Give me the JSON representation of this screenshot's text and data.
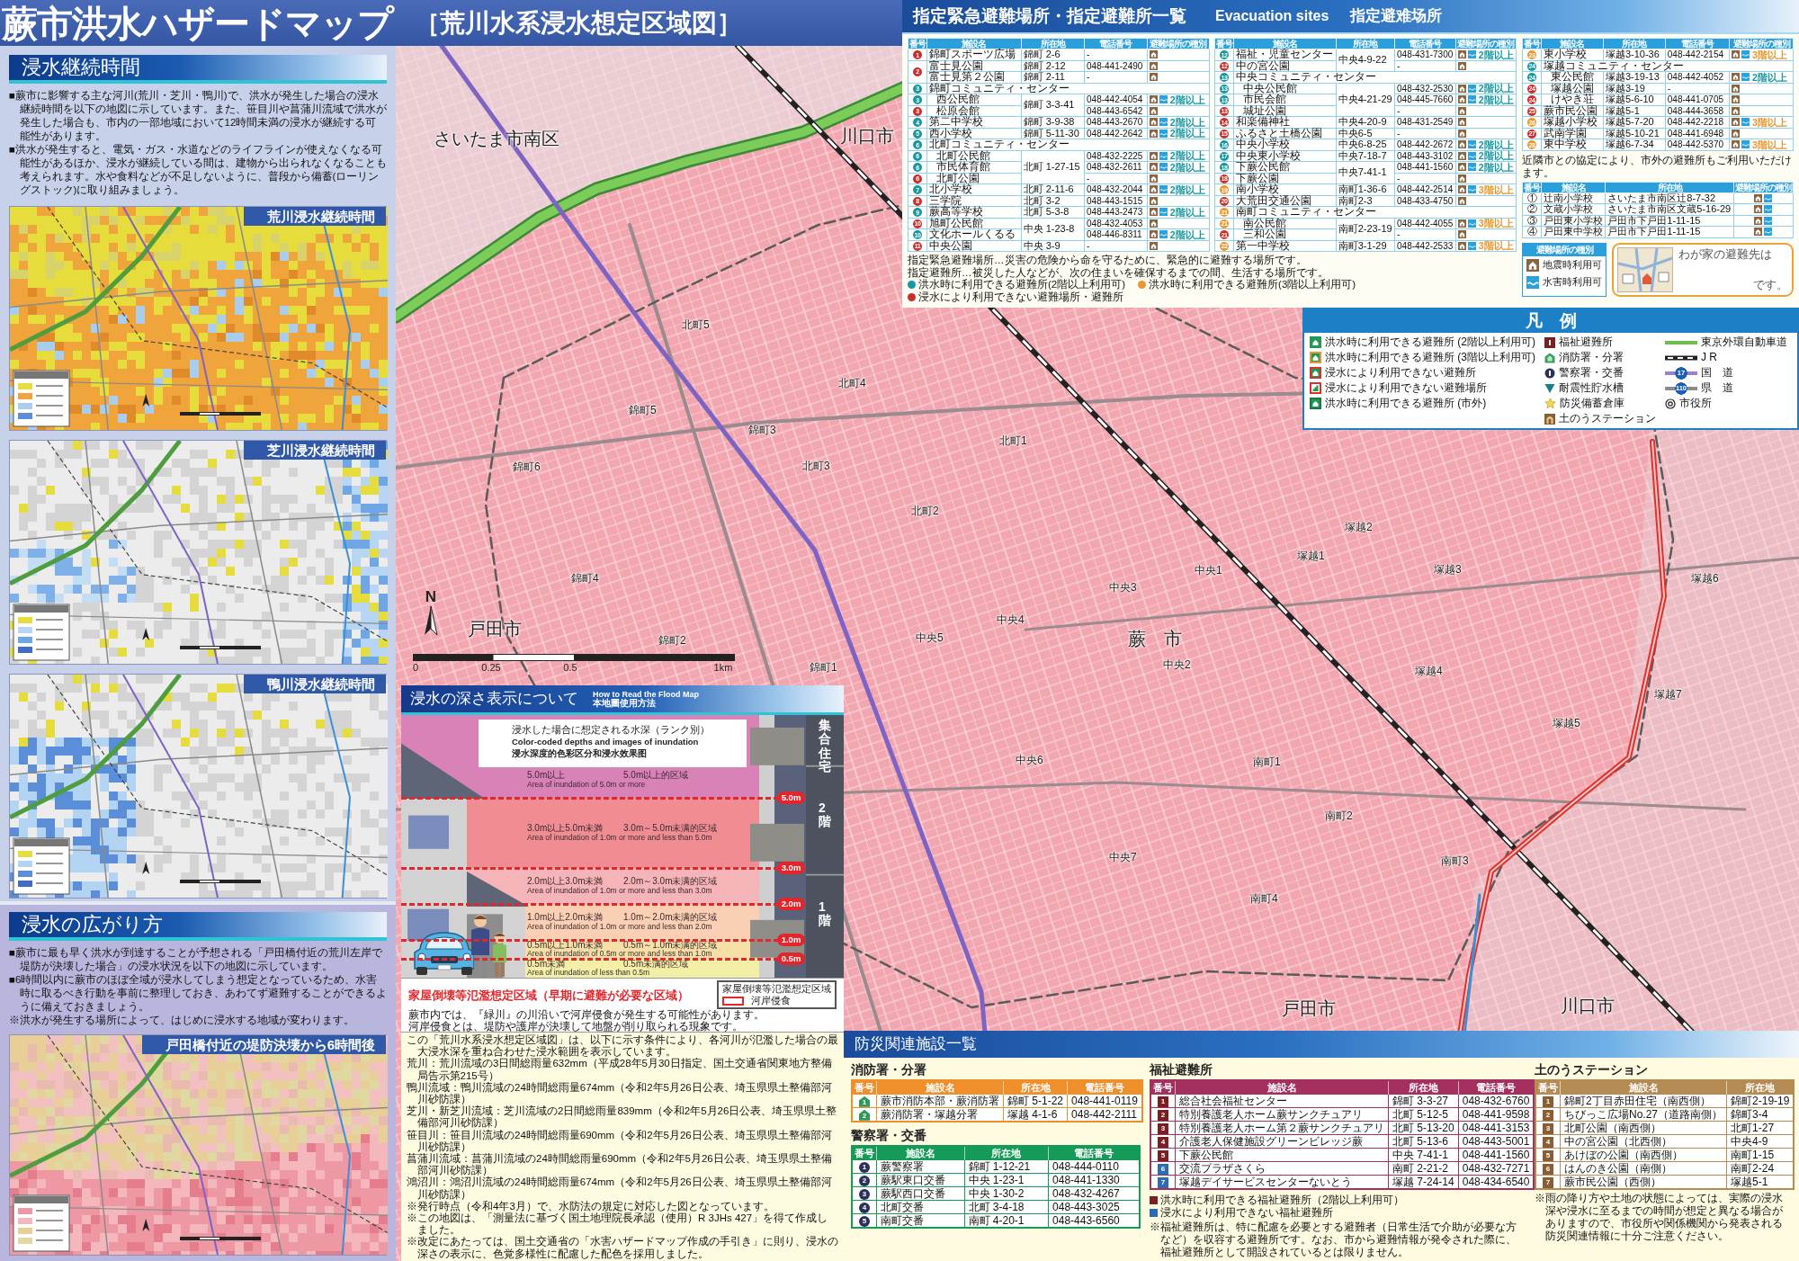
{
  "header": {
    "title": "蕨市洪水ハザードマップ",
    "subtitle": "［荒川水系浸水想定区域図］"
  },
  "duration": {
    "heading": "浸水継続時間",
    "paragraphs": [
      "■蕨市に影響する主な河川(荒川・芝川・鴨川)で、洪水が発生した場合の浸水継続時間を以下の地図に示しています。また、笹目川や菖蒲川流域で洪水が発生した場合も、市内の一部地域において12時間未満の浸水が継続する可能性があります。",
      "■洪水が発生すると、電気・ガス・水道などのライフラインが使えなくなる可能性があるほか、浸水が継続している間は、建物から出られなくなることも考えられます。水や食料などが不足しないように、普段から備蓄(ローリングストック)に取り組みましょう。"
    ],
    "maps": [
      {
        "title": "荒川浸水継続時間",
        "kind": "wide"
      },
      {
        "title": "芝川浸水継続時間",
        "kind": "east"
      },
      {
        "title": "鴨川浸水継続時間",
        "kind": "west"
      }
    ]
  },
  "spread": {
    "heading": "浸水の広がり方",
    "paragraphs": [
      "■蕨市に最も早く洪水が到達することが予想される「戸田橋付近の荒川左岸で堤防が決壊した場合」の浸水状況を以下の地図に示しています。",
      "■6時間以内に蕨市のほぼ全域が浸水してしまう想定となっているため、水害時に取るべき行動を事前に整理しておき、あわてず避難することができるように備えておきましょう。",
      "※洪水が発生する場所によって、はじめに浸水する地域が変わります。"
    ],
    "map": {
      "title": "戸田橋付近の堤防決壊から6時間後",
      "kind": "breach"
    }
  },
  "map": {
    "labels": [
      {
        "text": "さいたま市南区",
        "kind": "city"
      },
      {
        "text": "川口市",
        "kind": "city"
      },
      {
        "text": "蕨　市",
        "kind": "city"
      },
      {
        "text": "戸田市",
        "kind": "city"
      },
      {
        "text": "戸田市",
        "kind": "city"
      },
      {
        "text": "川口市",
        "kind": "city"
      },
      {
        "text": "北町5",
        "kind": "district"
      },
      {
        "text": "北町4",
        "kind": "district"
      },
      {
        "text": "北町1",
        "kind": "district"
      },
      {
        "text": "北町3",
        "kind": "district"
      },
      {
        "text": "北町2",
        "kind": "district"
      },
      {
        "text": "錦町5",
        "kind": "district"
      },
      {
        "text": "錦町3",
        "kind": "district"
      },
      {
        "text": "錦町6",
        "kind": "district"
      },
      {
        "text": "錦町4",
        "kind": "district"
      },
      {
        "text": "錦町2",
        "kind": "district"
      },
      {
        "text": "錦町1",
        "kind": "district"
      },
      {
        "text": "中央1",
        "kind": "district"
      },
      {
        "text": "中央3",
        "kind": "district"
      },
      {
        "text": "中央4",
        "kind": "district"
      },
      {
        "text": "中央5",
        "kind": "district"
      },
      {
        "text": "中央2",
        "kind": "district"
      },
      {
        "text": "中央6",
        "kind": "district"
      },
      {
        "text": "中央7",
        "kind": "district"
      },
      {
        "text": "南町1",
        "kind": "district"
      },
      {
        "text": "南町2",
        "kind": "district"
      },
      {
        "text": "南町3",
        "kind": "district"
      },
      {
        "text": "南町4",
        "kind": "district"
      },
      {
        "text": "塚越2",
        "kind": "district"
      },
      {
        "text": "塚越1",
        "kind": "district"
      },
      {
        "text": "塚越3",
        "kind": "district"
      },
      {
        "text": "塚越6",
        "kind": "district"
      },
      {
        "text": "塚越4",
        "kind": "district"
      },
      {
        "text": "塚越7",
        "kind": "district"
      },
      {
        "text": "塚越5",
        "kind": "district"
      }
    ],
    "north": "N",
    "scale": [
      "0",
      "0.25",
      "0.5",
      "1km"
    ]
  },
  "evacuation": {
    "title": "指定緊急避難場所・指定避難所一覧",
    "title_en": "Evacuation sites",
    "title_zh": "指定避难场所",
    "tables": [
      {
        "columns": [
          "番号",
          "施設名",
          "所在地",
          "電話番号",
          "避難場所の種別"
        ],
        "rows": [
          {
            "kind": "site",
            "no": "1",
            "color": "#c9302c",
            "name": "錦町スポーツ広場",
            "address": "錦町 2-6",
            "phone": "-",
            "quake": true,
            "flood": false
          },
          {
            "kind": "shared_number",
            "no": "2",
            "color": "#c9302c",
            "sites": [
              {
                "name": "富士見公園",
                "address": "錦町 2-12",
                "phone": "048-441-2490",
                "quake": true,
                "flood": false
              },
              {
                "name": "富士見第２公園",
                "address": "錦町 2-11",
                "phone": "-",
                "quake": true,
                "flood": false
              }
            ]
          },
          {
            "kind": "group",
            "no": "3",
            "color": "#17989e",
            "name": "錦町コミュニティ・センター",
            "rows": [
              {
                "kind": "shared_address",
                "address": "錦町 3-3-41",
                "sites": [
                  {
                    "no": "3",
                    "color": "#17989e",
                    "name": "西公民館",
                    "phone": "048-442-4054",
                    "quake": true,
                    "flood": true,
                    "floor": "2階以上"
                  },
                  {
                    "no": "3",
                    "color": "#c9302c",
                    "name": "松原会館",
                    "phone": "048-443-6542",
                    "quake": true,
                    "flood": false
                  }
                ]
              }
            ]
          },
          {
            "kind": "site",
            "no": "4",
            "color": "#17989e",
            "name": "第二中学校",
            "address": "錦町 3-9-38",
            "phone": "048-443-2670",
            "quake": true,
            "flood": true,
            "floor": "2階以上"
          },
          {
            "kind": "site",
            "no": "5",
            "color": "#17989e",
            "name": "西小学校",
            "address": "錦町 5-11-30",
            "phone": "048-442-2642",
            "quake": true,
            "flood": true,
            "floor": "2階以上"
          },
          {
            "kind": "group",
            "no": "6",
            "color": "#17989e",
            "name": "北町コミュニティ・センター",
            "rows": [
              {
                "kind": "shared_address",
                "address": "北町 1-27-15",
                "sites": [
                  {
                    "no": "6",
                    "color": "#17989e",
                    "name": "北町公民館",
                    "phone": "048-432-2225",
                    "quake": true,
                    "flood": true,
                    "floor": "2階以上"
                  },
                  {
                    "no": "6",
                    "color": "#17989e",
                    "name": "市民体育館",
                    "phone": "048-432-2611",
                    "quake": true,
                    "flood": true,
                    "floor": "2階以上"
                  },
                  {
                    "no": "6",
                    "color": "#c9302c",
                    "name": "北町公園",
                    "phone": "-",
                    "quake": true,
                    "flood": false
                  }
                ]
              }
            ]
          },
          {
            "kind": "site",
            "no": "7",
            "color": "#17989e",
            "name": "北小学校",
            "address": "北町 2-11-6",
            "phone": "048-432-2044",
            "quake": true,
            "flood": true,
            "floor": "2階以上"
          },
          {
            "kind": "site",
            "no": "8",
            "color": "#c9302c",
            "name": "三学院",
            "address": "北町 3-2",
            "phone": "048-443-1515",
            "quake": true,
            "flood": false
          },
          {
            "kind": "site",
            "no": "9",
            "color": "#17989e",
            "name": "蕨高等学校",
            "address": "北町 5-3-8",
            "phone": "048-443-2473",
            "quake": true,
            "flood": true,
            "floor": "2階以上"
          },
          {
            "kind": "shared_address",
            "address": "中央 1-23-8",
            "sites": [
              {
                "no": "10",
                "color": "#c9302c",
                "name": "旭町公民館",
                "phone": "048-432-4053",
                "quake": true,
                "flood": false
              },
              {
                "no": "10",
                "color": "#17989e",
                "name": "文化ホールくるる",
                "phone": "048-446-8311",
                "quake": true,
                "flood": true,
                "floor": "2階以上"
              }
            ]
          },
          {
            "kind": "site",
            "no": "11",
            "color": "#c9302c",
            "name": "中央公園",
            "address": "中央 3-9",
            "phone": "-",
            "quake": true,
            "flood": false
          }
        ]
      },
      {
        "columns": [
          "番号",
          "施設名",
          "所在地",
          "電話番号",
          "避難場所の種別"
        ],
        "rows": [
          {
            "kind": "shared_address",
            "address": "中央4-9-22",
            "sites": [
              {
                "no": "12",
                "color": "#17989e",
                "name": "福祉・児童センター",
                "phone": "048-431-7300",
                "quake": true,
                "flood": true,
                "floor": "2階以上"
              },
              {
                "no": "12",
                "color": "#c9302c",
                "name": "中の宮公園",
                "phone": "-",
                "quake": true,
                "flood": false
              }
            ]
          },
          {
            "kind": "group",
            "no": "13",
            "color": "#17989e",
            "name": "中央コミュニティ・センター",
            "rows": [
              {
                "kind": "shared_address",
                "address": "中央4-21-29",
                "sites": [
                  {
                    "no": "13",
                    "color": "#17989e",
                    "name": "中央公民館",
                    "phone": "048-432-2530",
                    "quake": true,
                    "flood": true,
                    "floor": "2階以上"
                  },
                  {
                    "no": "13",
                    "color": "#17989e",
                    "name": "市民会館",
                    "phone": "048-445-7660",
                    "quake": true,
                    "flood": true,
                    "floor": "2階以上"
                  },
                  {
                    "no": "13",
                    "color": "#c9302c",
                    "name": "城址公園",
                    "phone": "-",
                    "quake": true,
                    "flood": false
                  }
                ]
              }
            ]
          },
          {
            "kind": "site",
            "no": "14",
            "color": "#c9302c",
            "name": "和楽備神社",
            "address": "中央4-20-9",
            "phone": "048-431-2549",
            "quake": true,
            "flood": false
          },
          {
            "kind": "site",
            "no": "15",
            "color": "#c9302c",
            "name": "ふるさと土橋公園",
            "address": "中央6-5",
            "phone": "-",
            "quake": true,
            "flood": false
          },
          {
            "kind": "site",
            "no": "16",
            "color": "#17989e",
            "name": "中央小学校",
            "address": "中央6-8-25",
            "phone": "048-442-2672",
            "quake": true,
            "flood": true,
            "floor": "2階以上"
          },
          {
            "kind": "site",
            "no": "17",
            "color": "#17989e",
            "name": "中央東小学校",
            "address": "中央7-18-7",
            "phone": "048-443-3102",
            "quake": true,
            "flood": true,
            "floor": "2階以上"
          },
          {
            "kind": "shared_address",
            "address": "中央7-41-1",
            "sites": [
              {
                "no": "18",
                "color": "#17989e",
                "name": "下蕨公民館",
                "phone": "048-441-1560",
                "quake": true,
                "flood": true,
                "floor": "2階以上"
              },
              {
                "no": "18",
                "color": "#c9302c",
                "name": "下蕨公園",
                "phone": "-",
                "quake": true,
                "flood": false
              }
            ]
          },
          {
            "kind": "site",
            "no": "19",
            "color": "#e8982f",
            "name": "南小学校",
            "address": "南町1-36-6",
            "phone": "048-442-2514",
            "quake": true,
            "flood": true,
            "floor": "3階以上"
          },
          {
            "kind": "site",
            "no": "20",
            "color": "#c9302c",
            "name": "大荒田交通公園",
            "address": "南町2-3",
            "phone": "048-433-4750",
            "quake": true,
            "flood": false
          },
          {
            "kind": "group",
            "no": "21",
            "color": "#e8982f",
            "name": "南町コミュニティ・センター",
            "rows": [
              {
                "kind": "shared_address",
                "address": "南町2-23-19",
                "sites": [
                  {
                    "no": "21",
                    "color": "#e8982f",
                    "name": "南公民館",
                    "phone": "048-442-4055",
                    "quake": true,
                    "flood": true,
                    "floor": "3階以上"
                  },
                  {
                    "no": "21",
                    "color": "#c9302c",
                    "name": "三和公園",
                    "phone": "-",
                    "quake": true,
                    "flood": false
                  }
                ]
              }
            ]
          },
          {
            "kind": "site",
            "no": "22",
            "color": "#e8982f",
            "name": "第一中学校",
            "address": "南町3-1-29",
            "phone": "048-442-2533",
            "quake": true,
            "flood": true,
            "floor": "3階以上"
          }
        ]
      },
      {
        "columns": [
          "番号",
          "施設名",
          "所在地",
          "電話番号",
          "避難場所の種別"
        ],
        "rows": [
          {
            "kind": "site",
            "no": "23",
            "color": "#e8982f",
            "name": "東小学校",
            "address": "塚越3-10-36",
            "phone": "048-442-2154",
            "quake": true,
            "flood": true,
            "floor": "3階以上"
          },
          {
            "kind": "group",
            "no": "24",
            "color": "#17989e",
            "name": "塚越コミュニティ・センター",
            "rows": [
              {
                "kind": "site",
                "no": "24",
                "color": "#17989e",
                "name": "東公民館",
                "address": "塚越3-19-13",
                "phone": "048-442-4052",
                "quake": true,
                "flood": true,
                "floor": "2階以上"
              },
              {
                "kind": "site",
                "no": "24",
                "color": "#c9302c",
                "name": "塚越公園",
                "address": "塚越3-19",
                "phone": "-",
                "quake": true,
                "flood": false
              },
              {
                "kind": "site",
                "no": "24",
                "color": "#c9302c",
                "name": "けやき荘",
                "address": "塚越5-6-10",
                "phone": "048-441-0705",
                "quake": true,
                "flood": false
              }
            ]
          },
          {
            "kind": "site",
            "no": "25",
            "color": "#c9302c",
            "name": "蕨市民公園",
            "address": "塚越5-1",
            "phone": "048-444-3658",
            "quake": true,
            "flood": false
          },
          {
            "kind": "site",
            "no": "26",
            "color": "#e8982f",
            "name": "塚越小学校",
            "address": "塚越5-7-20",
            "phone": "048-442-2218",
            "quake": true,
            "flood": true,
            "floor": "3階以上"
          },
          {
            "kind": "site",
            "no": "27",
            "color": "#c9302c",
            "name": "武南学園",
            "address": "塚越5-10-21",
            "phone": "048-441-6948",
            "quake": true,
            "flood": false
          },
          {
            "kind": "site",
            "no": "28",
            "color": "#e8982f",
            "name": "東中学校",
            "address": "塚越6-7-34",
            "phone": "048-442-5370",
            "quake": true,
            "flood": true,
            "floor": "3階以上"
          }
        ]
      }
    ],
    "neighbor_note": "近隣市との協定により、市外の避難所もご利用いただけます。",
    "neighbor_columns": [
      "番号",
      "施設名",
      "所在地",
      "避難場所の種別"
    ],
    "neighbors": [
      {
        "no": "①",
        "name": "辻南小学校",
        "address": "さいたま市南区辻8-7-32",
        "quake": true,
        "flood": true
      },
      {
        "no": "②",
        "name": "文蔵小学校",
        "address": "さいたま市南区文蔵5-16-29",
        "quake": true,
        "flood": true
      },
      {
        "no": "③",
        "name": "戸田東小学校",
        "address": "戸田市下戸田1-11-15",
        "quake": true,
        "flood": true
      },
      {
        "no": "④",
        "name": "戸田東中学校",
        "address": "戸田市下戸田1-11-15",
        "quake": true,
        "flood": true
      }
    ],
    "kinds": {
      "title": "避難場所の種別",
      "items": [
        {
          "kind": "quake",
          "label": "地震時利用可"
        },
        {
          "kind": "flood",
          "label": "水害時利用可"
        }
      ]
    },
    "memo": {
      "line1": "わが家の避難先は",
      "line2": "です。"
    },
    "definitions": [
      "指定緊急避難場所…災害の危険から命を守るために、緊急的に避難する場所です。",
      "指定避難所…被災した人などが、次の住まいを確保するまでの間、生活する場所です。"
    ],
    "status_legend": [
      {
        "label": "洪水時に利用できる避難所(2階以上利用可)",
        "color": "#17989e"
      },
      {
        "label": "洪水時に利用できる避難所(3階以上利用可)",
        "color": "#e8982f"
      },
      {
        "label": "浸水により利用できない避難場所・避難所",
        "color": "#c9302c"
      }
    ]
  },
  "legend": {
    "title": "凡　例",
    "columns": [
      {
        "items": [
          {
            "kind": "shelter_2f",
            "label": "洪水時に利用できる避難所 (2階以上利用可)"
          },
          {
            "kind": "shelter_3f",
            "label": "洪水時に利用できる避難所 (3階以上利用可)"
          },
          {
            "kind": "shelter_closed",
            "label": "浸水により利用できない避難所"
          },
          {
            "kind": "site_closed",
            "label": "浸水により利用できない避難場所"
          },
          {
            "kind": "shelter_outside",
            "label": "洪水時に利用できる避難所 (市外)"
          }
        ]
      },
      {
        "items": [
          {
            "kind": "welfare",
            "label": "福祉避難所"
          },
          {
            "kind": "fire",
            "label": "消防署・分署"
          },
          {
            "kind": "police",
            "label": "警察署・交番"
          },
          {
            "kind": "tank",
            "label": "耐震性貯水槽"
          },
          {
            "kind": "stockpile",
            "label": "防災備蓄倉庫"
          },
          {
            "kind": "sandbag",
            "label": "土のうステーション"
          }
        ]
      },
      {
        "items": [
          {
            "kind": "expressway",
            "label": "東京外環自動車道"
          },
          {
            "kind": "jr",
            "label": "J R"
          },
          {
            "kind": "national_road",
            "label": "国　道",
            "badge": "17"
          },
          {
            "kind": "prefectural_road",
            "label": "県　道",
            "badge": "110"
          },
          {
            "kind": "city_hall",
            "label": "市役所"
          }
        ]
      }
    ]
  },
  "depth": {
    "title": "浸水の深さ表示について",
    "title_en": "How to Read the Flood Map",
    "title_zh": "本地圖使用方法",
    "caption": {
      "title": "浸水した場合に想定される水深（ランク別）",
      "english": "Color-coded depths and images of inundation",
      "chinese": "浸水深度的色彩区分和浸水效果图"
    },
    "bands": [
      {
        "label": "5.0m以上",
        "label_zh": "5.0m以上的区域",
        "label_en": "Area of inundation of 5.0m or more",
        "color": "#d882b8"
      },
      {
        "label": "3.0m以上5.0m未満",
        "label_zh": "3.0m～5.0m未满的区域",
        "label_en": "Area of inundation of 1.0m or more and less than 5.0m",
        "color": "#f08d93",
        "marker": "5.0m"
      },
      {
        "label": "2.0m以上3.0m未満",
        "label_zh": "2.0m～3.0m未满的区域",
        "label_en": "Area of inundation of 1.0m or more and less than 3.0m",
        "color": "#f5b4b7",
        "marker": "3.0m"
      },
      {
        "label": "1.0m以上2.0m未満",
        "label_zh": "1.0m～2.0m未满的区域",
        "label_en": "Area of inundation of 1.0m or more and less than 2.0m",
        "color": "#fbcfb3",
        "marker": "2.0m"
      },
      {
        "label": "0.5m以上1.0m未満",
        "label_zh": "0.5m～1.0m未满的区域",
        "label_en": "Area of inundation of 0.5m or more and less than 1.0m",
        "color": "#f7e0a8",
        "marker": "1.0m"
      },
      {
        "label": "0.5m未満",
        "label_zh": "0.5m未满的区域",
        "label_en": "Area of inundation of less than 0.5m",
        "color": "#f4efa6",
        "marker": "0.5m"
      }
    ],
    "building": {
      "name": "集合住宅",
      "floors": [
        "2階",
        "1階"
      ]
    },
    "zone": {
      "title": "家屋倒壊等氾濫想定区域（早期に避難が必要な区域）",
      "lines": [
        "蕨市内では、『緑川』の川沿いで河岸侵食が発生する可能性があります。",
        "河岸侵食とは、堤防や護岸が決壊して地盤が削り取られる現象です。"
      ],
      "legend_title": "家屋倒壊等氾濫想定区域",
      "legend_item": "河岸侵食"
    },
    "notes": [
      "この「荒川水系浸水想定区域図」は、以下に示す条件により、各河川が氾濫した場合の最大浸水深を重ね合わせた浸水範囲を表示しています。",
      "荒川：荒川流域の3日間総雨量632mm（平成28年5月30日指定、国土交通省関東地方整備局告示第215号）",
      "鴨川流域：鴨川流域の24時間総雨量674mm（令和2年5月26日公表、埼玉県県土整備部河川砂防課）",
      "芝川・新芝川流域：芝川流域の2日間総雨量839mm（令和2年5月26日公表、埼玉県県土整備部河川砂防課）",
      "笹目川：笹目川流域の24時間総雨量690mm（令和2年5月26日公表、埼玉県県土整備部河川砂防課）",
      "菖蒲川流域：菖蒲川流域の24時間総雨量690mm（令和2年5月26日公表、埼玉県県土整備部河川砂防課）",
      "鴻沼川：鴻沼川流域の24時間総雨量674mm（令和2年5月26日公表、埼玉県県土整備部河川砂防課）",
      "※発行時点（令和4年3月）で、水防法の規定に対応した図となっています。",
      "※この地図は、「測量法に基づく国土地理院長承認（使用）R 3JHs 427」を得て作成しました。",
      "※改定にあたっては、国土交通省の「水害ハザードマップ作成の手引き」に則り、浸水の深さの表示に、色覚多様性に配慮した配色を採用しました。"
    ]
  },
  "facilities": {
    "title": "防災関連施設一覧",
    "sections": [
      {
        "kind": "fire",
        "title": "消防署・分署",
        "columns": [
          "番号",
          "施設名",
          "所在地",
          "電話番号"
        ],
        "rows": [
          {
            "no": "1",
            "name": "蕨市消防本部・蕨消防署",
            "address": "錦町 5-1-22",
            "phone": "048-441-0119"
          },
          {
            "no": "2",
            "name": "蕨消防署・塚越分署",
            "address": "塚越 4-1-6",
            "phone": "048-442-2111"
          }
        ]
      },
      {
        "kind": "police",
        "title": "警察署・交番",
        "columns": [
          "番号",
          "施設名",
          "所在地",
          "電話番号"
        ],
        "rows": [
          {
            "no": "1",
            "name": "蕨警察署",
            "address": "錦町 1-12-21",
            "phone": "048-444-0110"
          },
          {
            "no": "2",
            "name": "蕨駅東口交番",
            "address": "中央 1-23-1",
            "phone": "048-441-1330"
          },
          {
            "no": "3",
            "name": "蕨駅西口交番",
            "address": "中央 1-30-2",
            "phone": "048-432-4267"
          },
          {
            "no": "4",
            "name": "北町交番",
            "address": "北町 3-4-18",
            "phone": "048-443-3025"
          },
          {
            "no": "5",
            "name": "南町交番",
            "address": "南町 4-20-1",
            "phone": "048-443-6560"
          }
        ]
      },
      {
        "kind": "welfare",
        "title": "福祉避難所",
        "columns": [
          "番号",
          "施設名",
          "所在地",
          "電話番号"
        ],
        "rows": [
          {
            "no": "1",
            "name": "総合社会福祉センター",
            "address": "錦町 3-3-27",
            "phone": "048-432-6760",
            "color": "#7b1e22"
          },
          {
            "no": "2",
            "name": "特別養護老人ホーム蕨サンクチュアリ",
            "address": "北町 5-12-5",
            "phone": "048-441-9598",
            "color": "#7b1e22"
          },
          {
            "no": "3",
            "name": "特別養護老人ホーム第２蕨サンクチュアリ",
            "address": "北町 5-13-20",
            "phone": "048-441-3153",
            "color": "#7b1e22"
          },
          {
            "no": "4",
            "name": "介護老人保健施設グリーンビレッジ蕨",
            "address": "北町 5-13-6",
            "phone": "048-443-5001",
            "color": "#7b1e22"
          },
          {
            "no": "5",
            "name": "下蕨公民館",
            "address": "中央 7-41-1",
            "phone": "048-441-1560",
            "color": "#7b1e22"
          },
          {
            "no": "6",
            "name": "交流プラザさくら",
            "address": "南町 2-21-2",
            "phone": "048-432-7271",
            "color": "#2d6bb5"
          },
          {
            "no": "7",
            "name": "塚越デイサービスセンターないとう",
            "address": "塚越 7-24-14",
            "phone": "048-434-6540",
            "color": "#2d6bb5"
          }
        ],
        "legend": [
          {
            "label": "洪水時に利用できる福祉避難所（2階以上利用可）",
            "color": "#7b1e22"
          },
          {
            "label": "浸水により利用できない福祉避難所",
            "color": "#2d6bb5"
          }
        ],
        "note": "※福祉避難所は、特に配慮を必要とする避難者（日常生活で介助が必要な方など）を収容する避難所です。なお、市から避難情報が発令された際に、福祉避難所として開設されているとは限りません。"
      },
      {
        "kind": "sandbag",
        "title": "土のうステーション",
        "columns": [
          "番号",
          "施設名",
          "所在地"
        ],
        "rows": [
          {
            "no": "1",
            "name": "錦町2丁目赤田住宅（南西側）",
            "address": "錦町2-19-19"
          },
          {
            "no": "2",
            "name": "ちびっこ広場No.27（道路南側）",
            "address": "錦町3-4"
          },
          {
            "no": "3",
            "name": "北町公園（南西側）",
            "address": "北町1-27"
          },
          {
            "no": "4",
            "name": "中の宮公園（北西側）",
            "address": "中央4-9"
          },
          {
            "no": "5",
            "name": "あけぼの公園（南西側）",
            "address": "南町1-15"
          },
          {
            "no": "6",
            "name": "はんのき公園（南側）",
            "address": "南町2-24"
          },
          {
            "no": "7",
            "name": "蕨市民公園（西側）",
            "address": "塚越5-1"
          }
        ],
        "note": "※雨の降り方や土地の状態によっては、実際の浸水深や浸水に至るまでの時間が想定と異なる場合がありますので、市役所や関係機関から発表される防災関連情報に十分ご注意ください。"
      }
    ]
  }
}
